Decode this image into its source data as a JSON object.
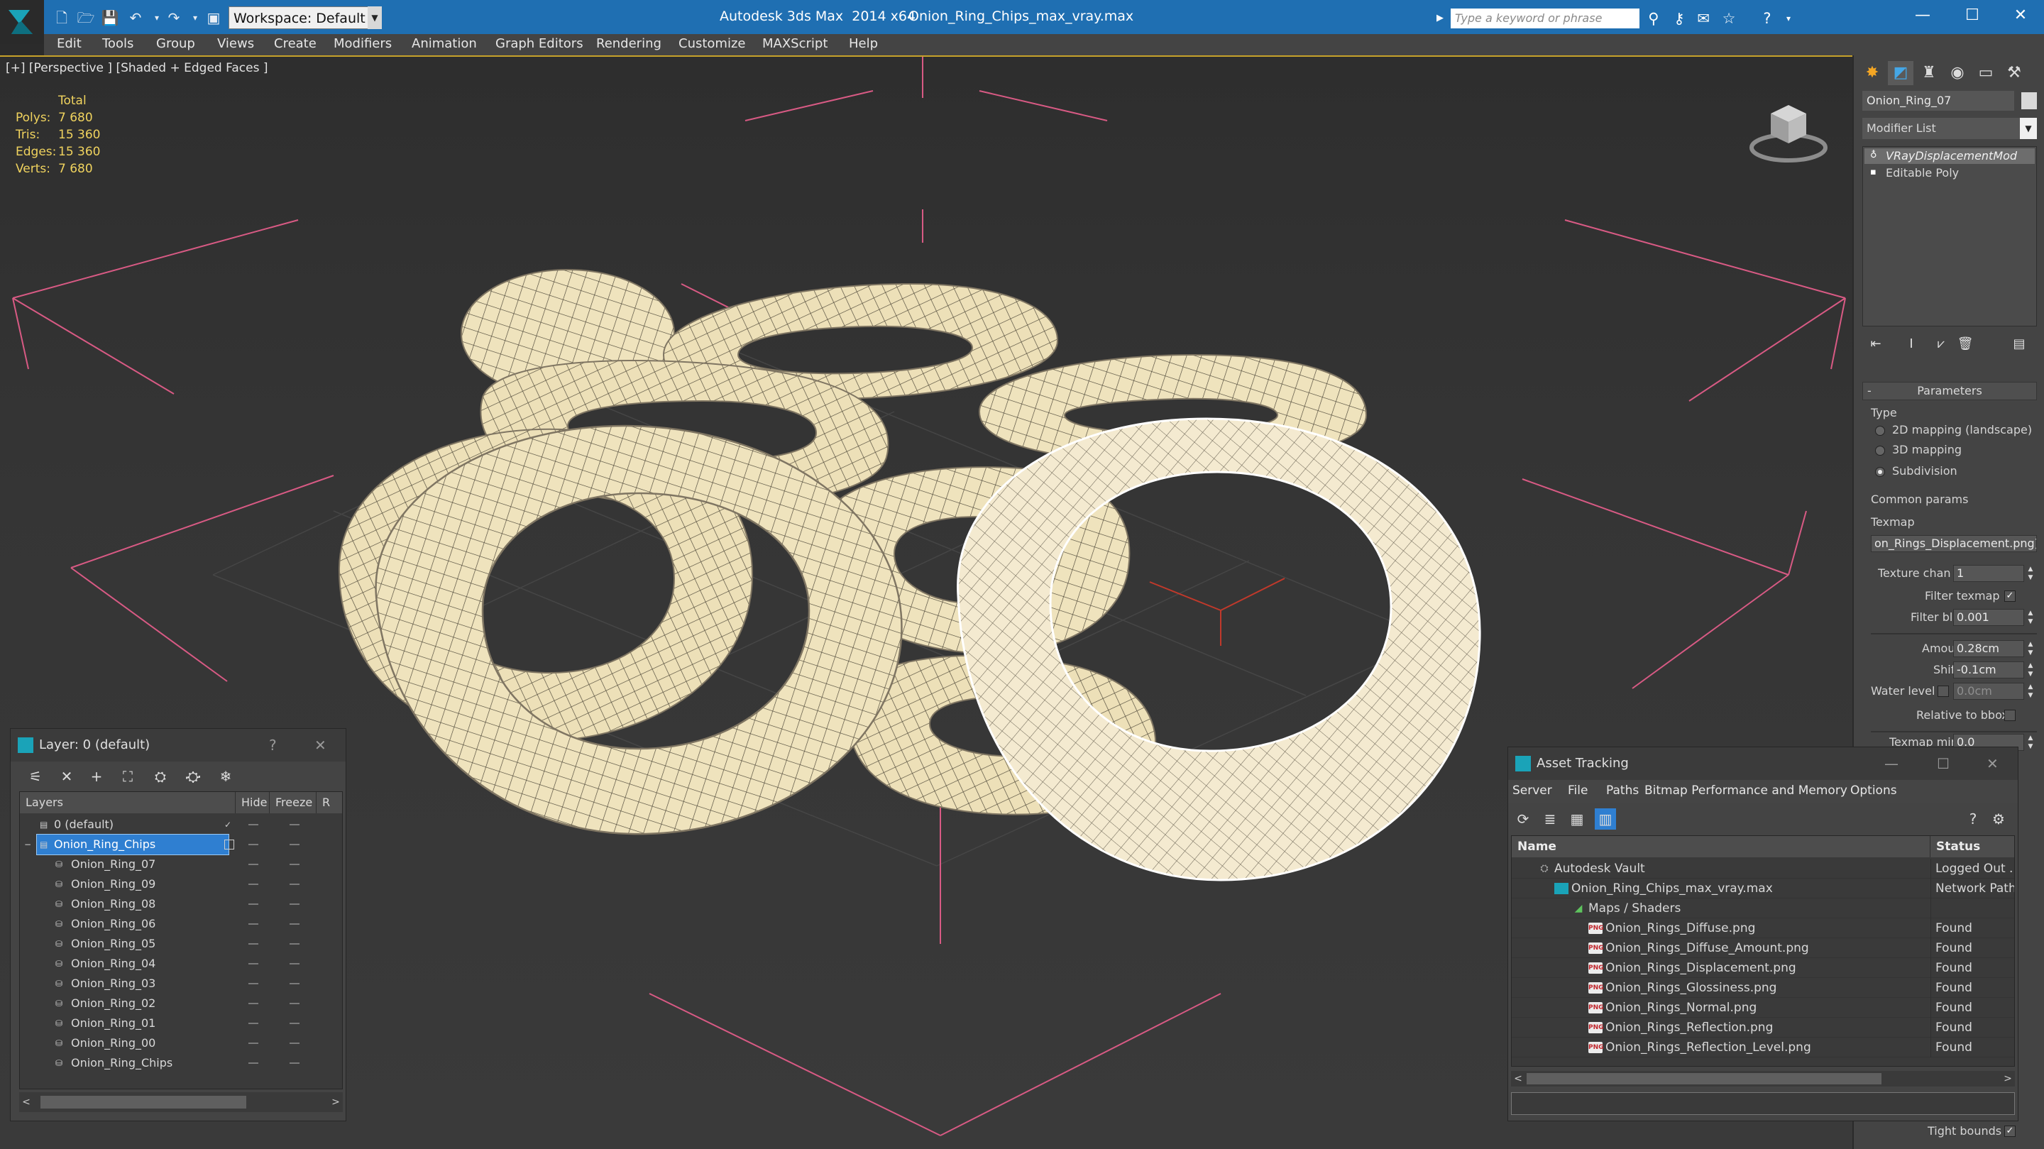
{
  "app": {
    "title": "Autodesk 3ds Max  2014 x64",
    "file": "Onion_Ring_Chips_max_vray.max",
    "workspace": "Workspace: Default",
    "search_placeholder": "Type a keyword or phrase"
  },
  "menu": [
    "Edit",
    "Tools",
    "Group",
    "Views",
    "Create",
    "Modifiers",
    "Animation",
    "Graph Editors",
    "Rendering",
    "Customize",
    "MAXScript",
    "Help"
  ],
  "viewport": {
    "label": "[+] [Perspective ] [Shaded + Edged Faces ]",
    "stats": {
      "total_label": "Total",
      "polys_label": "Polys:",
      "polys": "7 680",
      "tris_label": "Tris:",
      "tris": "15 360",
      "edges_label": "Edges:",
      "edges": "15 360",
      "verts_label": "Verts:",
      "verts": "7 680"
    }
  },
  "command_panel": {
    "object_name": "Onion_Ring_07",
    "modifier_list": "Modifier List",
    "stack": [
      "VRayDisplacementMod",
      "Editable Poly"
    ],
    "rollout": "Parameters",
    "type_label": "Type",
    "type_options": [
      "2D mapping (landscape)",
      "3D mapping",
      "Subdivision"
    ],
    "common_params": "Common params",
    "texmap_label": "Texmap",
    "texmap_value": "on_Rings_Displacement.png)",
    "texture_chan_label": "Texture chan",
    "texture_chan": "1",
    "filter_texmap_label": "Filter texmap",
    "filter_blur_label": "Filter blur",
    "filter_blur": "0.001",
    "amount_label": "Amount",
    "amount": "0.28cm",
    "shift_label": "Shift",
    "shift": "-0.1cm",
    "water_level_label": "Water level",
    "water_level": "0.0cm",
    "relative_bbox_label": "Relative to bbox",
    "texmap_min_label": "Texmap min",
    "texmap_min": "0.0",
    "tight_bounds_label": "Tight bounds"
  },
  "layer_explorer": {
    "title": "Layer: 0 (default)",
    "help": "?",
    "close": "✕",
    "columns": [
      "Layers",
      "Hide",
      "Freeze",
      "R"
    ],
    "layers": [
      {
        "name": "0 (default)"
      },
      {
        "name": "Onion_Ring_Chips"
      }
    ],
    "objects": [
      "Onion_Ring_07",
      "Onion_Ring_09",
      "Onion_Ring_08",
      "Onion_Ring_06",
      "Onion_Ring_05",
      "Onion_Ring_04",
      "Onion_Ring_03",
      "Onion_Ring_02",
      "Onion_Ring_01",
      "Onion_Ring_00",
      "Onion_Ring_Chips"
    ]
  },
  "asset_tracking": {
    "title": "Asset Tracking",
    "menu": [
      "Server",
      "File",
      "Paths",
      "Bitmap Performance and Memory",
      "Options"
    ],
    "columns": [
      "Name",
      "Status"
    ],
    "rows": [
      {
        "name": "Autodesk Vault",
        "status": "Logged Out ..."
      },
      {
        "name": "Onion_Ring_Chips_max_vray.max",
        "status": "Network Path"
      },
      {
        "name": "Maps / Shaders",
        "status": ""
      },
      {
        "name": "Onion_Rings_Diffuse.png",
        "status": "Found"
      },
      {
        "name": "Onion_Rings_Diffuse_Amount.png",
        "status": "Found"
      },
      {
        "name": "Onion_Rings_Displacement.png",
        "status": "Found"
      },
      {
        "name": "Onion_Rings_Glossiness.png",
        "status": "Found"
      },
      {
        "name": "Onion_Rings_Normal.png",
        "status": "Found"
      },
      {
        "name": "Onion_Rings_Reflection.png",
        "status": "Found"
      },
      {
        "name": "Onion_Rings_Reflection_Level.png",
        "status": "Found"
      }
    ],
    "png_badge": "PNG"
  },
  "colors": {
    "titlebar": "#1f6fb2",
    "stats": "#f0d35e",
    "ring_fill": "#efe3bd",
    "selection_blue": "#2f7fd1"
  }
}
